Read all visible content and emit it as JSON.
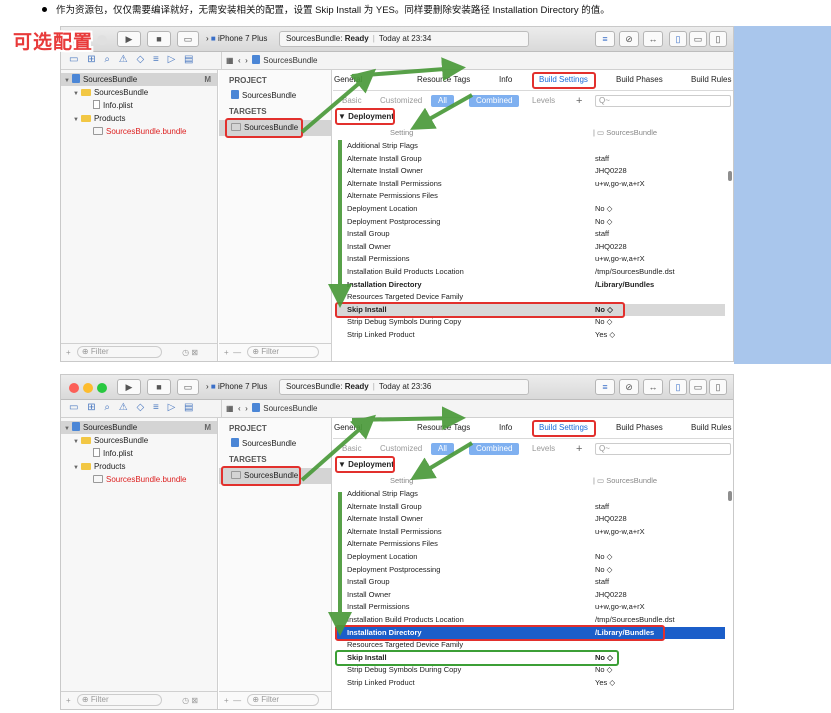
{
  "note": "作为资源包，仅仅需要编译就好，无需安装相关的配置，设置 Skip Install 为 YES。同样要删除安装路径 Installation Directory 的值。",
  "optional_tag": "可选配置",
  "device": "iPhone 7 Plus",
  "project_name": "SourcesBundle",
  "status_ready": "Ready",
  "nav_tree": {
    "root": "SourcesBundle",
    "root_badge": "M",
    "folder": "SourcesBundle",
    "info_plist": "Info.plist",
    "products": "Products",
    "bundle": "SourcesBundle.bundle",
    "filter_placeholder": "Filter"
  },
  "targets": {
    "project_header": "PROJECT",
    "project_item": "SourcesBundle",
    "targets_header": "TARGETS",
    "target_item": "SourcesBundle",
    "filter_placeholder": "Filter"
  },
  "tabs": [
    "General",
    "Resource Tags",
    "Info",
    "Build Settings",
    "Build Phases",
    "Build Rules"
  ],
  "subtabs": {
    "basic": "Basic",
    "customized": "Customized",
    "all": "All",
    "combined": "Combined",
    "levels": "Levels",
    "search_placeholder": "Q~"
  },
  "group": "Deployment",
  "col_setting": "Setting",
  "col_target": "SourcesBundle",
  "shot1": {
    "time": "Today at 23:34",
    "rows": [
      {
        "k": "Additional Strip Flags",
        "v": ""
      },
      {
        "k": "Alternate Install Group",
        "v": "staff"
      },
      {
        "k": "Alternate Install Owner",
        "v": "JHQ0228"
      },
      {
        "k": "Alternate Install Permissions",
        "v": "u+w,go-w,a+rX"
      },
      {
        "k": "Alternate Permissions Files",
        "v": ""
      },
      {
        "k": "Deployment Location",
        "v": "No ◇"
      },
      {
        "k": "Deployment Postprocessing",
        "v": "No ◇"
      },
      {
        "k": "Install Group",
        "v": "staff"
      },
      {
        "k": "Install Owner",
        "v": "JHQ0228"
      },
      {
        "k": "Install Permissions",
        "v": "u+w,go-w,a+rX"
      },
      {
        "k": "Installation Build Products Location",
        "v": "/tmp/SourcesBundle.dst"
      },
      {
        "k": "Installation Directory",
        "v": "/Library/Bundles"
      },
      {
        "k": "Resources Targeted Device Family",
        "v": ""
      },
      {
        "k": "Skip Install",
        "v": "No ◇"
      },
      {
        "k": "Strip Debug Symbols During Copy",
        "v": "No ◇"
      },
      {
        "k": "Strip Linked Product",
        "v": "Yes ◇"
      }
    ]
  },
  "shot2": {
    "time": "Today at 23:36",
    "rows": [
      {
        "k": "Additional Strip Flags",
        "v": ""
      },
      {
        "k": "Alternate Install Group",
        "v": "staff"
      },
      {
        "k": "Alternate Install Owner",
        "v": "JHQ0228"
      },
      {
        "k": "Alternate Install Permissions",
        "v": "u+w,go-w,a+rX"
      },
      {
        "k": "Alternate Permissions Files",
        "v": ""
      },
      {
        "k": "Deployment Location",
        "v": "No ◇"
      },
      {
        "k": "Deployment Postprocessing",
        "v": "No ◇"
      },
      {
        "k": "Install Group",
        "v": "staff"
      },
      {
        "k": "Install Owner",
        "v": "JHQ0228"
      },
      {
        "k": "Install Permissions",
        "v": "u+w,go-w,a+rX"
      },
      {
        "k": "Installation Build Products Location",
        "v": "/tmp/SourcesBundle.dst"
      },
      {
        "k": "Installation Directory",
        "v": "/Library/Bundles"
      },
      {
        "k": "Resources Targeted Device Family",
        "v": ""
      },
      {
        "k": "Skip Install",
        "v": "No ◇"
      },
      {
        "k": "Strip Debug Symbols During Copy",
        "v": "No ◇"
      },
      {
        "k": "Strip Linked Product",
        "v": "Yes ◇"
      }
    ]
  }
}
